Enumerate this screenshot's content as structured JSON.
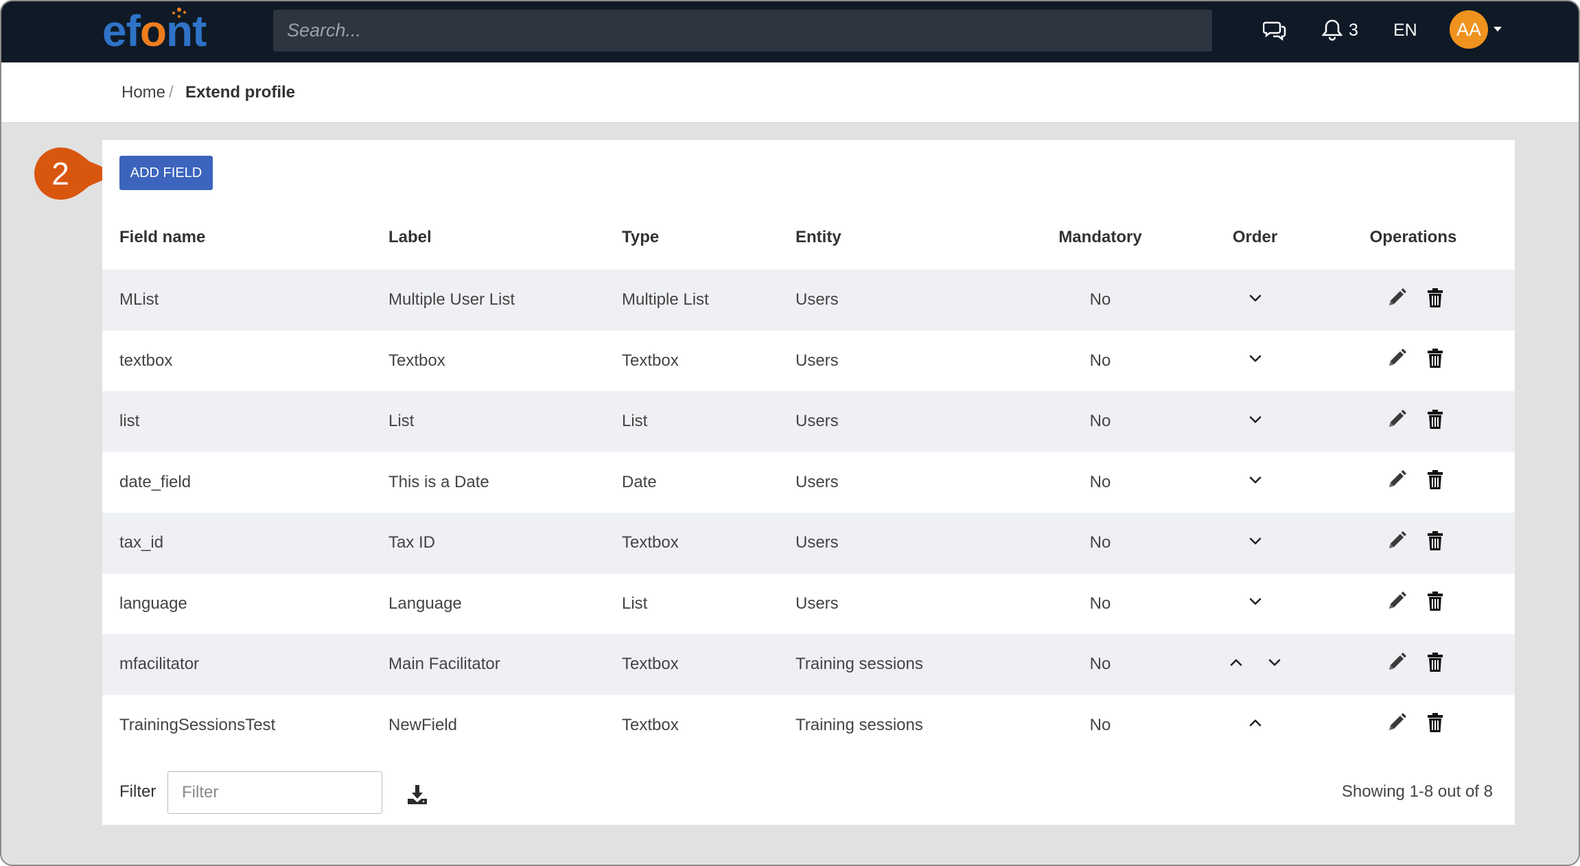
{
  "header": {
    "logo_text_before": "ef",
    "logo_text_o": "o",
    "logo_text_after": "nt",
    "search_placeholder": "Search...",
    "notification_count": "3",
    "language": "EN",
    "avatar_initials": "AA"
  },
  "breadcrumb": {
    "home": "Home",
    "separator": "/",
    "current": "Extend profile"
  },
  "toolbar": {
    "add_field_label": "ADD FIELD",
    "step_number": "2"
  },
  "table": {
    "columns": [
      "Field name",
      "Label",
      "Type",
      "Entity",
      "Mandatory",
      "Order",
      "Operations"
    ],
    "rows": [
      {
        "field_name": "MList",
        "label": "Multiple User List",
        "type": "Multiple List",
        "entity": "Users",
        "mandatory": "No",
        "order": [
          "down"
        ]
      },
      {
        "field_name": "textbox",
        "label": "Textbox",
        "type": "Textbox",
        "entity": "Users",
        "mandatory": "No",
        "order": [
          "down"
        ]
      },
      {
        "field_name": "list",
        "label": "List",
        "type": "List",
        "entity": "Users",
        "mandatory": "No",
        "order": [
          "down"
        ]
      },
      {
        "field_name": "date_field",
        "label": "This is a Date",
        "type": "Date",
        "entity": "Users",
        "mandatory": "No",
        "order": [
          "down"
        ]
      },
      {
        "field_name": "tax_id",
        "label": "Tax ID",
        "type": "Textbox",
        "entity": "Users",
        "mandatory": "No",
        "order": [
          "down"
        ]
      },
      {
        "field_name": "language",
        "label": "Language",
        "type": "List",
        "entity": "Users",
        "mandatory": "No",
        "order": [
          "down"
        ]
      },
      {
        "field_name": "mfacilitator",
        "label": "Main Facilitator",
        "type": "Textbox",
        "entity": "Training sessions",
        "mandatory": "No",
        "order": [
          "up",
          "down"
        ]
      },
      {
        "field_name": "TrainingSessionsTest",
        "label": "NewField",
        "type": "Textbox",
        "entity": "Training sessions",
        "mandatory": "No",
        "order": [
          "up"
        ]
      }
    ]
  },
  "footer": {
    "filter_label": "Filter",
    "filter_placeholder": "Filter",
    "showing_text": "Showing 1-8 out of 8"
  },
  "colors": {
    "topbar": "#0f1a26",
    "brand_blue": "#2f73c8",
    "brand_orange": "#ef7d1e",
    "button_blue": "#3c64bd",
    "step_badge": "#d9560f",
    "row_stripe": "#eef0f4"
  }
}
